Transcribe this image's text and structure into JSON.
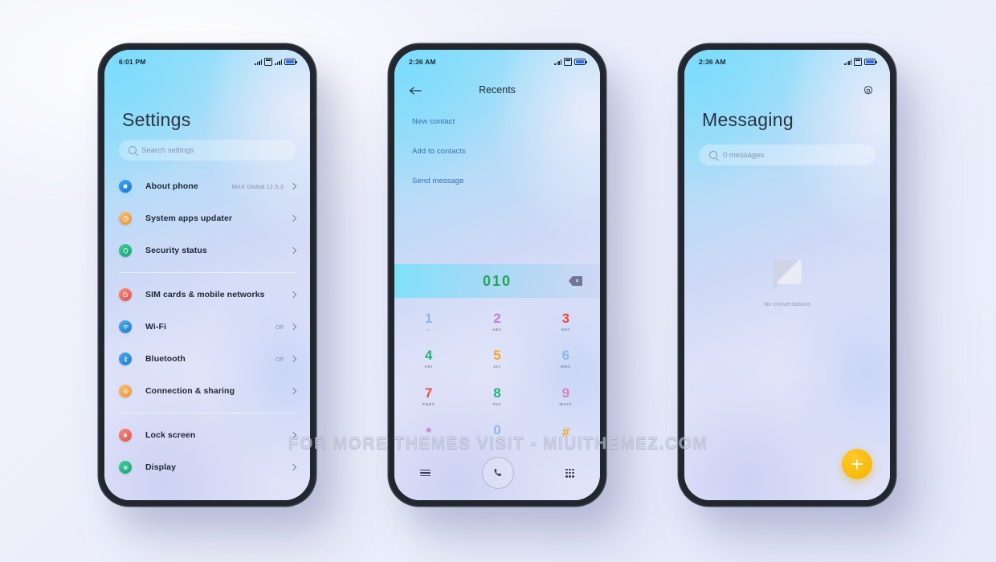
{
  "watermark": "FOR MORE THEMES VISIT - MIUITHEMEZ.COM",
  "phone_settings": {
    "status": {
      "time": "6:01 PM"
    },
    "title": "Settings",
    "search": {
      "placeholder": "Search settings",
      "icon": "search-icon"
    },
    "groups": [
      {
        "items": [
          {
            "label": "About phone",
            "value": "MIUI Global 12.5.3",
            "icon": "about-phone-icon",
            "color": "#2196f3"
          },
          {
            "label": "System apps updater",
            "value": "",
            "icon": "updater-icon",
            "color": "#f5a04a"
          },
          {
            "label": "Security status",
            "value": "",
            "icon": "shield-icon",
            "color": "#25b37a"
          }
        ]
      },
      {
        "items": [
          {
            "label": "SIM cards & mobile networks",
            "value": "",
            "icon": "sim-card-icon",
            "color": "#ef6a5e"
          },
          {
            "label": "Wi-Fi",
            "value": "Off",
            "icon": "wifi-icon",
            "color": "#2f8fe0"
          },
          {
            "label": "Bluetooth",
            "value": "Off",
            "icon": "bluetooth-icon",
            "color": "#2f8fe0"
          },
          {
            "label": "Connection & sharing",
            "value": "",
            "icon": "connection-sharing-icon",
            "color": "#f5a04a"
          }
        ]
      },
      {
        "items": [
          {
            "label": "Lock screen",
            "value": "",
            "icon": "lock-icon",
            "color": "#ef6a5e"
          },
          {
            "label": "Display",
            "value": "",
            "icon": "display-brightness-icon",
            "color": "#24b583"
          }
        ]
      }
    ]
  },
  "phone_dialer": {
    "status": {
      "time": "2:36 AM"
    },
    "back_icon": "back-arrow-icon",
    "title": "Recents",
    "actions": [
      "New contact",
      "Add to contacts",
      "Send message"
    ],
    "dialed_number": "010",
    "number_color": "#22a357",
    "delete_icon": "backspace-icon",
    "keys": [
      {
        "digit": "1",
        "letters": "∞",
        "color": "#8fb7e8"
      },
      {
        "digit": "2",
        "letters": "ABC",
        "color": "#c07fd8"
      },
      {
        "digit": "3",
        "letters": "DEF",
        "color": "#ef4b47"
      },
      {
        "digit": "4",
        "letters": "GHI",
        "color": "#1fb573"
      },
      {
        "digit": "5",
        "letters": "JKL",
        "color": "#f4a62a"
      },
      {
        "digit": "6",
        "letters": "MNO",
        "color": "#8fb7e8"
      },
      {
        "digit": "7",
        "letters": "PQRS",
        "color": "#ef4b47"
      },
      {
        "digit": "8",
        "letters": "TUV",
        "color": "#1fb573"
      },
      {
        "digit": "9",
        "letters": "WXYZ",
        "color": "#d87fc8"
      },
      {
        "digit": "*",
        "letters": "",
        "color": "#c07fd8"
      },
      {
        "digit": "0",
        "letters": "+",
        "color": "#8fb7e8"
      },
      {
        "digit": "#",
        "letters": "",
        "color": "#f4a62a"
      }
    ],
    "bottom": {
      "menu_icon": "menu-icon",
      "call_icon": "phone-call-icon",
      "keypad_icon": "keypad-grid-icon"
    }
  },
  "phone_messaging": {
    "status": {
      "time": "2:36 AM"
    },
    "settings_icon": "gear-icon",
    "title": "Messaging",
    "search": {
      "placeholder": "0 messages",
      "icon": "search-icon"
    },
    "empty": {
      "icon": "message-bubble-icon",
      "text": "No conversations"
    },
    "fab": {
      "icon": "plus-icon",
      "color": "#f5b400"
    }
  }
}
